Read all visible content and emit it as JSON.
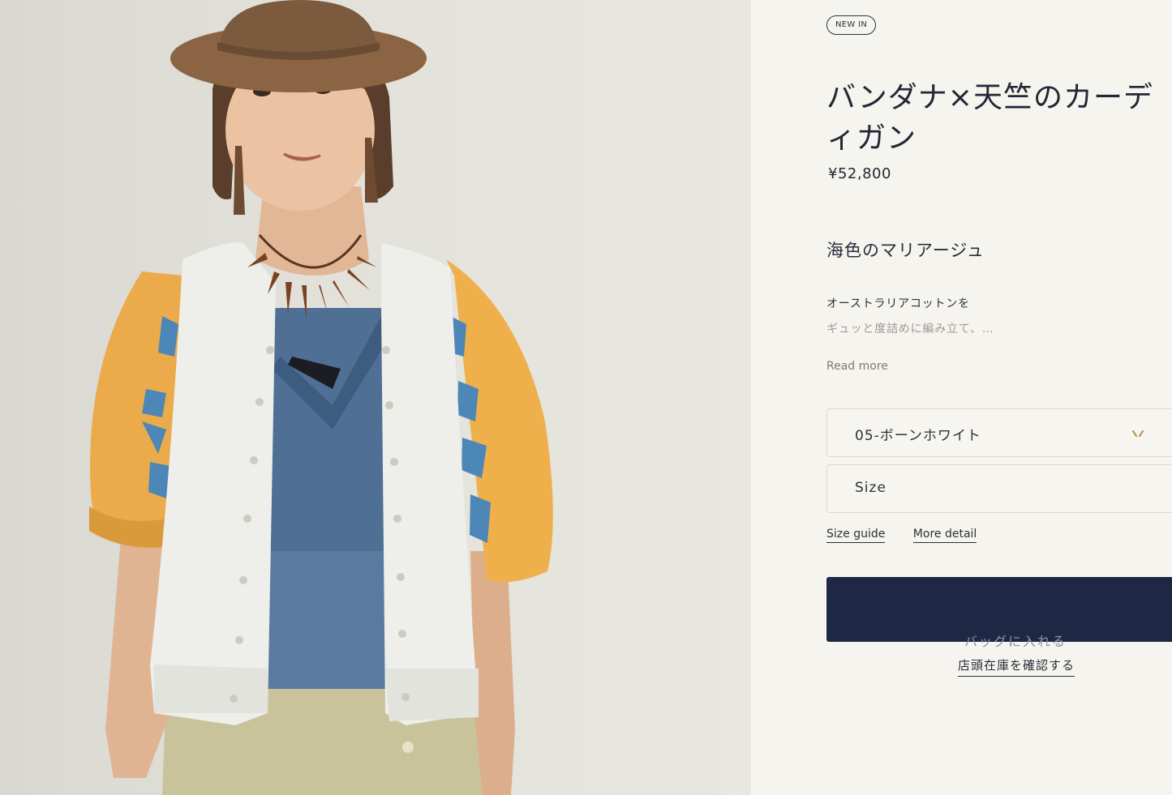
{
  "product": {
    "badge": "NEW IN",
    "title": "バンダナ×天竺のカーディガン",
    "price": "¥52,800",
    "subtitle": "海色のマリアージュ",
    "description_line1": "オーストラリアコットンを",
    "description_line2": "ギュッと度詰めに編み立て、…",
    "read_more_label": "Read more"
  },
  "options": {
    "color_selected": "05-ボーンホワイト",
    "size_placeholder": "Size"
  },
  "links": {
    "size_guide": "Size guide",
    "more_detail": "More detail"
  },
  "actions": {
    "add_to_bag": "バッグに入れる",
    "check_store_stock": "店頭在庫を確認する"
  },
  "colors": {
    "panel_background": "#f6f4ee",
    "primary_button": "#1e2845",
    "text": "#232635"
  }
}
